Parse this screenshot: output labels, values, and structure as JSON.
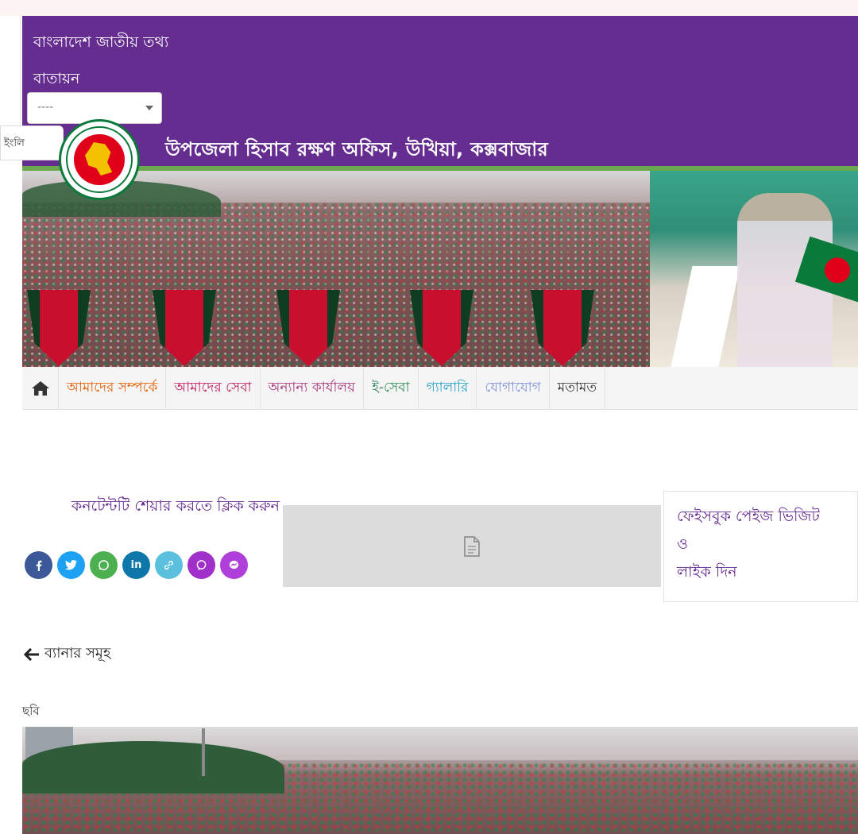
{
  "portal": {
    "title_line1": "বাংলাদেশ জাতীয় তথ্য",
    "title_line2": "বাতায়ন",
    "select_value": "----",
    "language_button": "ইংলি",
    "office_name": "উপজেলা হিসাব রক্ষণ অফিস, উখিয়া, কক্সবাজার"
  },
  "colors": {
    "header_bg": "#662d91",
    "header_stripe": "#6aa84f",
    "nav_about": "#e65c00",
    "nav_services": "#c2185b",
    "nav_other_offices": "#a8327a",
    "nav_eservice": "#2e8b57",
    "nav_gallery": "#1fa0c6",
    "nav_contact": "#7e8fdb",
    "nav_feedback": "#333333",
    "share_facebook": "#3b5998",
    "share_twitter": "#1da1f2",
    "share_whatsapp": "#4caf50",
    "share_linkedin": "#0e76a8",
    "share_link": "#5bc0de",
    "share_viber": "#a12fc9",
    "share_messenger": "#b03fd9"
  },
  "nav": {
    "home_icon": "home-icon",
    "items": [
      {
        "label": "আমাদের সম্পর্কে"
      },
      {
        "label": "আমাদের সেবা"
      },
      {
        "label": "অন্যান্য কার্যালয়"
      },
      {
        "label": "ই-সেবা"
      },
      {
        "label": "গ্যালারি"
      },
      {
        "label": "যোগাযোগ"
      },
      {
        "label": "মতামত"
      }
    ]
  },
  "share": {
    "text": "কনটেন্টটি শেয়ার করতে ক্লিক করুন",
    "icons": [
      "facebook-icon",
      "twitter-icon",
      "whatsapp-icon",
      "linkedin-icon",
      "link-icon",
      "viber-icon",
      "messenger-icon"
    ]
  },
  "facebook_box": {
    "line1": "ফেইসবুক পেইজ ভিজিট",
    "line2": "ও",
    "line3": "লাইক দিন"
  },
  "content": {
    "back_link": "ব্যানার সমূহ",
    "image_label": "ছবি"
  }
}
